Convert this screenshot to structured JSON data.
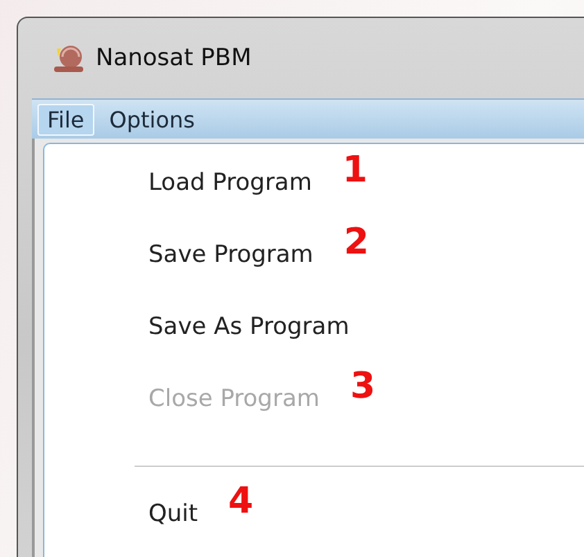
{
  "window": {
    "title": "Nanosat PBM"
  },
  "menubar": [
    {
      "label": "File",
      "selected": true
    },
    {
      "label": "Options",
      "selected": false
    }
  ],
  "file_menu": [
    {
      "kind": "item",
      "label": "Load Program",
      "disabled": false,
      "annotation": "1"
    },
    {
      "kind": "item",
      "label": "Save Program",
      "disabled": false,
      "annotation": "2"
    },
    {
      "kind": "item",
      "label": "Save As Program",
      "disabled": false
    },
    {
      "kind": "item",
      "label": "Close Program",
      "disabled": true,
      "annotation": "3"
    },
    {
      "kind": "separator"
    },
    {
      "kind": "item",
      "label": "Quit",
      "disabled": false,
      "annotation": "4"
    }
  ]
}
